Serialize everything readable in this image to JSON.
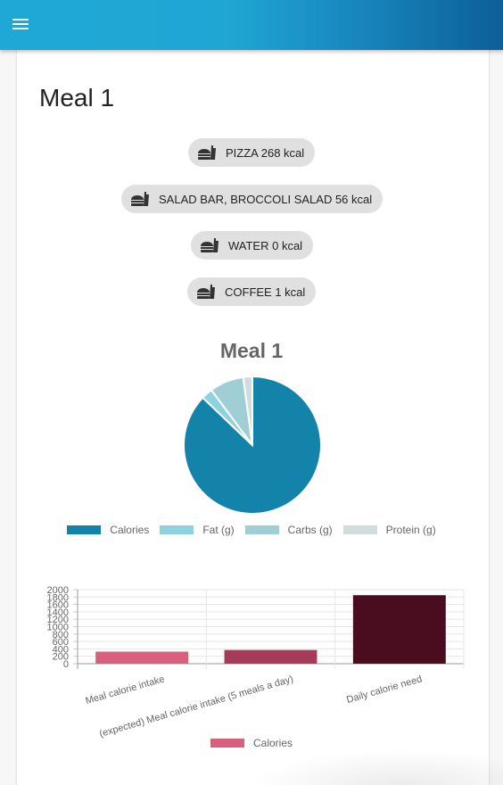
{
  "app_bar": {
    "menu_icon": "hamburger-menu-icon"
  },
  "page": {
    "title": "Meal 1"
  },
  "meal_items": [
    {
      "label": "PIZZA 268 kcal",
      "icon": "fast-food-icon"
    },
    {
      "label": "SALAD BAR, BROCCOLI SALAD 56 kcal",
      "icon": "fast-food-icon"
    },
    {
      "label": "WATER 0 kcal",
      "icon": "fast-food-icon"
    },
    {
      "label": "COFFEE 1 kcal",
      "icon": "fast-food-icon"
    }
  ],
  "colors": {
    "calories": "#1483aa",
    "fat": "#8dd2de",
    "carbs": "#9fcfd4",
    "protein": "#d2dcdc",
    "bar_intake": "#d8607c",
    "bar_expected": "#a63a5c",
    "bar_need": "#4a0d20"
  },
  "chart_data": [
    {
      "type": "pie",
      "title": "Meal 1",
      "legend_position": "bottom",
      "labels": [
        "Calories",
        "Fat (g)",
        "Carbs (g)",
        "Protein (g)"
      ],
      "values": [
        325,
        10,
        30,
        8
      ]
    },
    {
      "type": "bar",
      "categories": [
        "Meal calorie intake",
        "(expected) Meal calorie intake (5 meals a day)",
        "Daily calorie need"
      ],
      "series": [
        {
          "name": "Calories",
          "values": [
            325,
            370,
            1850
          ]
        }
      ],
      "ylim": [
        0,
        2000
      ],
      "yticks": [
        0,
        200,
        400,
        600,
        800,
        1000,
        1200,
        1400,
        1600,
        1800,
        2000
      ],
      "grid": true,
      "legend_position": "bottom"
    }
  ]
}
